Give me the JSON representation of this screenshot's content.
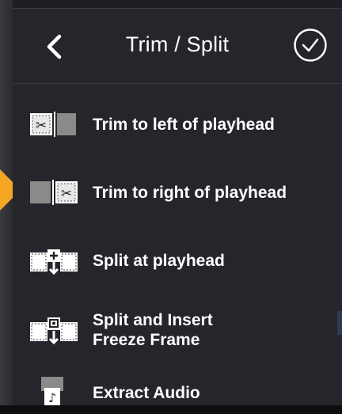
{
  "header": {
    "title": "Trim / Split",
    "back_icon": "chevron-left-icon",
    "done_icon": "checkmark-circle-icon"
  },
  "menu": {
    "items": [
      {
        "label": "Trim to left of playhead",
        "icon": "trim-left-icon"
      },
      {
        "label": "Trim to right of playhead",
        "icon": "trim-right-icon"
      },
      {
        "label": "Split at playhead",
        "icon": "split-icon"
      },
      {
        "label_line1": "Split and Insert",
        "label_line2": "Freeze Frame",
        "icon": "freeze-frame-icon"
      },
      {
        "label": "Extract Audio",
        "icon": "extract-audio-icon"
      }
    ]
  },
  "colors": {
    "background": "#25262c",
    "text": "#ffffff",
    "accent_arrow": "#f5a623"
  }
}
